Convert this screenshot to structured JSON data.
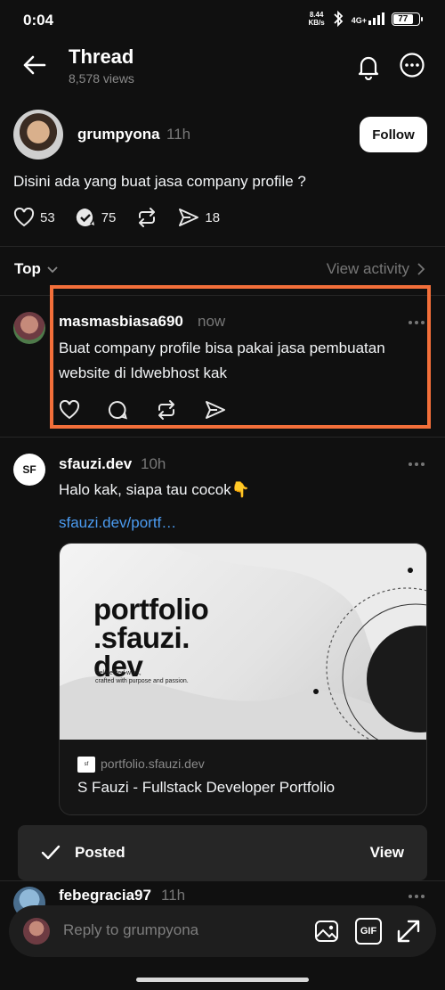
{
  "status_bar": {
    "time": "0:04",
    "net_speed_value": "8.44",
    "net_speed_unit": "KB/s",
    "network": "4G+",
    "battery": "77"
  },
  "header": {
    "title": "Thread",
    "views": "8,578 views"
  },
  "original_post": {
    "username": "grumpyona",
    "time": "11h",
    "follow_label": "Follow",
    "text": "Disini ada yang buat jasa company profile ?",
    "likes": "53",
    "replies": "75",
    "shares": "18"
  },
  "sort": {
    "label": "Top",
    "view_activity": "View activity"
  },
  "replies": [
    {
      "username": "masmasbiasa690",
      "time": "now",
      "text": "Buat company profile bisa pakai jasa pembuatan website di Idwebhost kak"
    },
    {
      "username": "sfauzi.dev",
      "time": "10h",
      "text": "Halo kak, siapa tau cocok👇",
      "link": "sfauzi.dev/portf…",
      "card": {
        "logo_line1": "portfolio",
        "logo_line2": ".sfauzi.",
        "logo_line3": "dev",
        "tagline_line1": "Seletected work,",
        "tagline_line2": "crafted with purpose and passion.",
        "domain": "portfolio.sfauzi.dev",
        "title": "S Fauzi - Fullstack Developer Portfolio"
      }
    },
    {
      "username": "febegracia97",
      "time": "11h"
    }
  ],
  "toast": {
    "label": "Posted",
    "action": "View"
  },
  "compose": {
    "placeholder": "Reply to grumpyona",
    "gif_label": "GIF"
  },
  "colors": {
    "background": "#101010",
    "highlight": "#f36f3a",
    "link": "#4b9bf0"
  }
}
